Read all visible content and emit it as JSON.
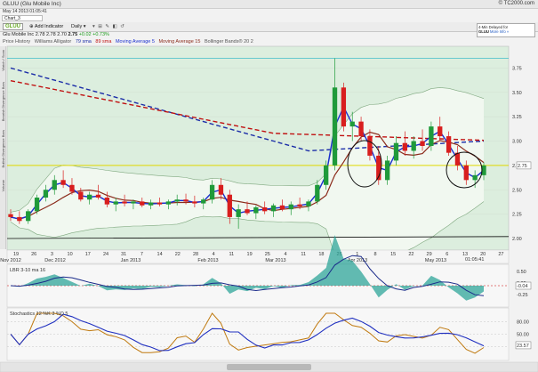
{
  "window": {
    "title": "GLUU (Glu Mobile Inc)",
    "brand": "© TC2000.com",
    "date_line": "May 14 2013 01:05:41"
  },
  "tab": {
    "label": "Chart_3"
  },
  "toolbar": {
    "symbol": "GLUU",
    "add_indicator": "Add Indicator",
    "period": "Daily",
    "icons": "▾ ⊞ ✎ ◧ ↺"
  },
  "delayed_box": {
    "line1": "4-Min Delayed for",
    "line2": "GLUU",
    "line3": "More Info »"
  },
  "quote": {
    "name": "Glu Mobile Inc",
    "open": "2.78",
    "high": "2.78",
    "low": "2.70",
    "close": "2.75",
    "change": "+0.02  +0.73%"
  },
  "legend": {
    "price_history": "Price History",
    "alligator": "Williams Alligator",
    "sma79": "79 sma",
    "sma89": "89 sma",
    "ma5": "Moving Average 5",
    "ma15": "Moving Average 15",
    "bb": "Bollinger Bands® 20 2"
  },
  "sidebar_labels": [
    "Watch / Scan",
    "Bearish Divergence Bars",
    "Bullish Divergence Bars",
    "Volume"
  ],
  "colors": {
    "up": "#1f9a3a",
    "down": "#d81e1e",
    "ma5": "#1a2fd0",
    "ma15": "#8b2a1a",
    "sma79": "#1c2ea8",
    "sma89": "#c01010",
    "bb": "#7fa87f",
    "yellow": "#e0d800",
    "teal": "#3fbdc8",
    "lbr_fill": "#2fa59a",
    "stoch_slow": "#2030c0",
    "stoch_fast": "#c07a10"
  },
  "chart_data": {
    "type": "candlestick",
    "y_ticks": [
      "3.75",
      "3.50",
      "3.25",
      "3.00",
      "2.75",
      "2.50",
      "2.25",
      "2.00"
    ],
    "ylim": [
      2.0,
      3.9
    ],
    "current_price_tag": "2.75",
    "x_ticks": [
      "19",
      "26",
      "3",
      "10",
      "17",
      "24",
      "31",
      "7",
      "14",
      "22",
      "28",
      "4",
      "11",
      "19",
      "25",
      "4",
      "11",
      "18",
      "25",
      "1",
      "8",
      "15",
      "22",
      "29",
      "6",
      "13",
      "20",
      "27"
    ],
    "x_months": [
      "Nov 2012",
      "Dec 2012",
      "Jan 2013",
      "Feb 2013",
      "Mar 2013",
      "Apr 2013",
      "May 2013"
    ],
    "timestamp": "01:05:41",
    "candles": [
      [
        2.25,
        2.3,
        2.18,
        2.22
      ],
      [
        2.22,
        2.28,
        2.15,
        2.18
      ],
      [
        2.18,
        2.3,
        2.15,
        2.28
      ],
      [
        2.28,
        2.45,
        2.25,
        2.42
      ],
      [
        2.42,
        2.55,
        2.38,
        2.5
      ],
      [
        2.5,
        2.65,
        2.45,
        2.6
      ],
      [
        2.6,
        2.7,
        2.52,
        2.55
      ],
      [
        2.55,
        2.62,
        2.45,
        2.48
      ],
      [
        2.48,
        2.52,
        2.38,
        2.4
      ],
      [
        2.4,
        2.48,
        2.35,
        2.45
      ],
      [
        2.45,
        2.55,
        2.4,
        2.42
      ],
      [
        2.42,
        2.48,
        2.32,
        2.35
      ],
      [
        2.35,
        2.42,
        2.28,
        2.38
      ],
      [
        2.38,
        2.45,
        2.33,
        2.36
      ],
      [
        2.36,
        2.4,
        2.3,
        2.38
      ],
      [
        2.38,
        2.42,
        2.32,
        2.34
      ],
      [
        2.34,
        2.4,
        2.3,
        2.37
      ],
      [
        2.37,
        2.42,
        2.33,
        2.35
      ],
      [
        2.35,
        2.4,
        2.3,
        2.38
      ],
      [
        2.38,
        2.45,
        2.34,
        2.4
      ],
      [
        2.4,
        2.46,
        2.35,
        2.38
      ],
      [
        2.38,
        2.44,
        2.32,
        2.36
      ],
      [
        2.36,
        2.42,
        2.3,
        2.4
      ],
      [
        2.4,
        2.6,
        2.36,
        2.55
      ],
      [
        2.55,
        2.62,
        2.4,
        2.45
      ],
      [
        2.45,
        2.5,
        2.15,
        2.22
      ],
      [
        2.22,
        2.35,
        2.1,
        2.3
      ],
      [
        2.3,
        2.38,
        2.24,
        2.26
      ],
      [
        2.26,
        2.34,
        2.2,
        2.32
      ],
      [
        2.32,
        2.38,
        2.25,
        2.28
      ],
      [
        2.28,
        2.36,
        2.22,
        2.34
      ],
      [
        2.34,
        2.4,
        2.28,
        2.3
      ],
      [
        2.3,
        2.38,
        2.24,
        2.35
      ],
      [
        2.35,
        2.42,
        2.3,
        2.33
      ],
      [
        2.33,
        2.4,
        2.28,
        2.38
      ],
      [
        2.38,
        2.6,
        2.35,
        2.55
      ],
      [
        2.55,
        2.8,
        2.5,
        2.75
      ],
      [
        2.75,
        3.85,
        2.7,
        3.55
      ],
      [
        3.55,
        3.6,
        3.1,
        3.15
      ],
      [
        3.15,
        3.3,
        3.0,
        3.2
      ],
      [
        3.2,
        3.25,
        3.0,
        3.05
      ],
      [
        3.05,
        3.12,
        2.8,
        2.85
      ],
      [
        2.85,
        2.95,
        2.55,
        2.6
      ],
      [
        2.6,
        2.85,
        2.55,
        2.8
      ],
      [
        2.8,
        3.05,
        2.75,
        2.98
      ],
      [
        2.98,
        3.1,
        2.85,
        2.9
      ],
      [
        2.9,
        3.05,
        2.82,
        3.0
      ],
      [
        3.0,
        3.12,
        2.9,
        2.95
      ],
      [
        2.95,
        3.2,
        2.9,
        3.15
      ],
      [
        3.15,
        3.25,
        3.0,
        3.05
      ],
      [
        3.05,
        3.1,
        2.85,
        2.88
      ],
      [
        2.88,
        2.95,
        2.7,
        2.75
      ],
      [
        2.75,
        2.8,
        2.55,
        2.6
      ],
      [
        2.6,
        2.7,
        2.52,
        2.65
      ],
      [
        2.65,
        2.78,
        2.6,
        2.75
      ]
    ],
    "lbr_label": "LBR 3-10",
    "lbr_params": "ma 16",
    "lbr_ticks": [
      "0.50",
      "0.25",
      "-0.25"
    ],
    "lbr_value_tag": "-0.04",
    "stoch_label": "Stochastics 12 %K 3 %D 5",
    "stoch_ticks": [
      "80.00",
      "50.00",
      "20.00"
    ],
    "stoch_value_tag": "23.57"
  }
}
